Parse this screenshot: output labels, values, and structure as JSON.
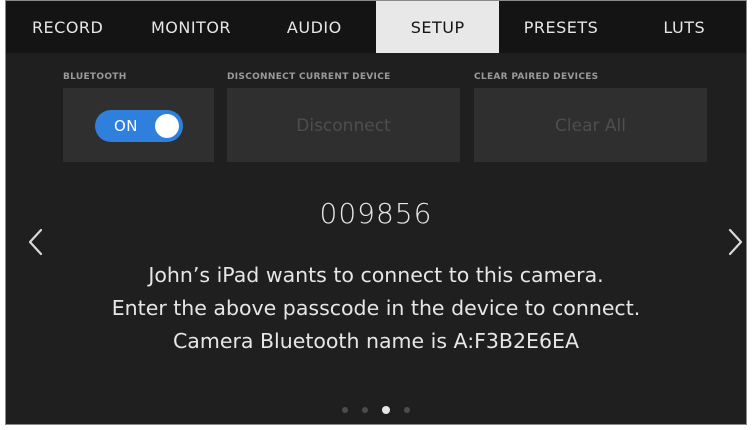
{
  "tabs": [
    {
      "label": "RECORD",
      "active": false
    },
    {
      "label": "MONITOR",
      "active": false
    },
    {
      "label": "AUDIO",
      "active": false
    },
    {
      "label": "SETUP",
      "active": true
    },
    {
      "label": "PRESETS",
      "active": false
    },
    {
      "label": "LUTS",
      "active": false
    }
  ],
  "bluetooth": {
    "label": "BLUETOOTH",
    "toggle_text": "ON",
    "enabled": true
  },
  "disconnect": {
    "label": "DISCONNECT CURRENT DEVICE",
    "button": "Disconnect",
    "disabled": true
  },
  "clear_paired": {
    "label": "CLEAR PAIRED DEVICES",
    "button": "Clear All",
    "disabled": true
  },
  "pairing": {
    "passcode": "009856",
    "lines": [
      "John’s iPad wants to connect to this camera.",
      "Enter the above passcode in the device to connect.",
      "Camera Bluetooth name is A:F3B2E6EA"
    ]
  },
  "pager": {
    "total": 4,
    "current": 3
  },
  "colors": {
    "accent": "#2f7fdc",
    "background": "#1f1f1f",
    "panel": "#2f2f2f",
    "active_tab": "#e8e8e8"
  },
  "icons": {
    "prev": "chevron-left-icon",
    "next": "chevron-right-icon"
  }
}
